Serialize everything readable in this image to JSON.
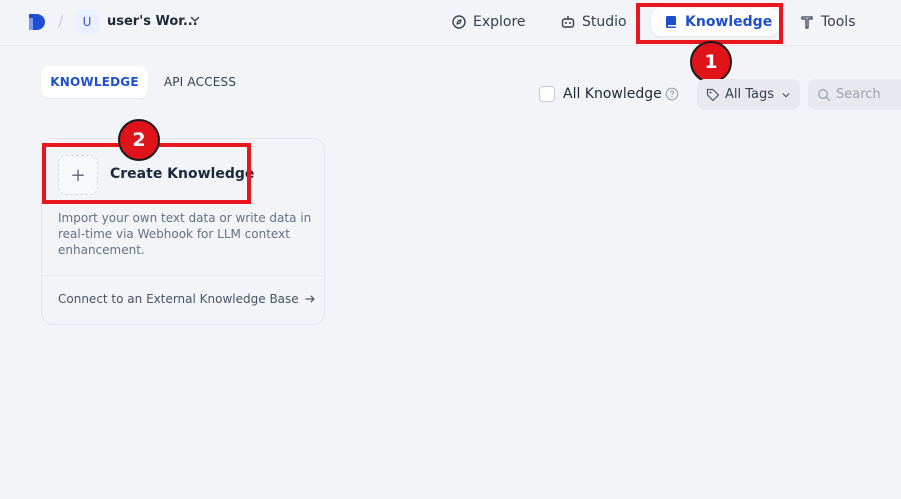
{
  "header": {
    "workspace_initial": "U",
    "workspace_name": "user's Wor...",
    "nav": {
      "explore": "Explore",
      "studio": "Studio",
      "knowledge": "Knowledge",
      "tools": "Tools"
    }
  },
  "annotations": {
    "badge1": "1",
    "badge2": "2"
  },
  "tabs": {
    "knowledge": "KNOWLEDGE",
    "api_access": "API ACCESS"
  },
  "filters": {
    "all_knowledge_label": "All Knowledge",
    "all_knowledge_checked": false,
    "tags_label": "All Tags",
    "search_placeholder": "Search"
  },
  "create_card": {
    "plus": "+",
    "title": "Create Knowledge",
    "description": "Import your own text data or write data in real-time via Webhook for LLM context enhancement.",
    "external_link": "Connect to an External Knowledge Base"
  },
  "colors": {
    "accent": "#1f4fd1",
    "highlight": "#e8171e",
    "background": "#f2f4f7"
  }
}
